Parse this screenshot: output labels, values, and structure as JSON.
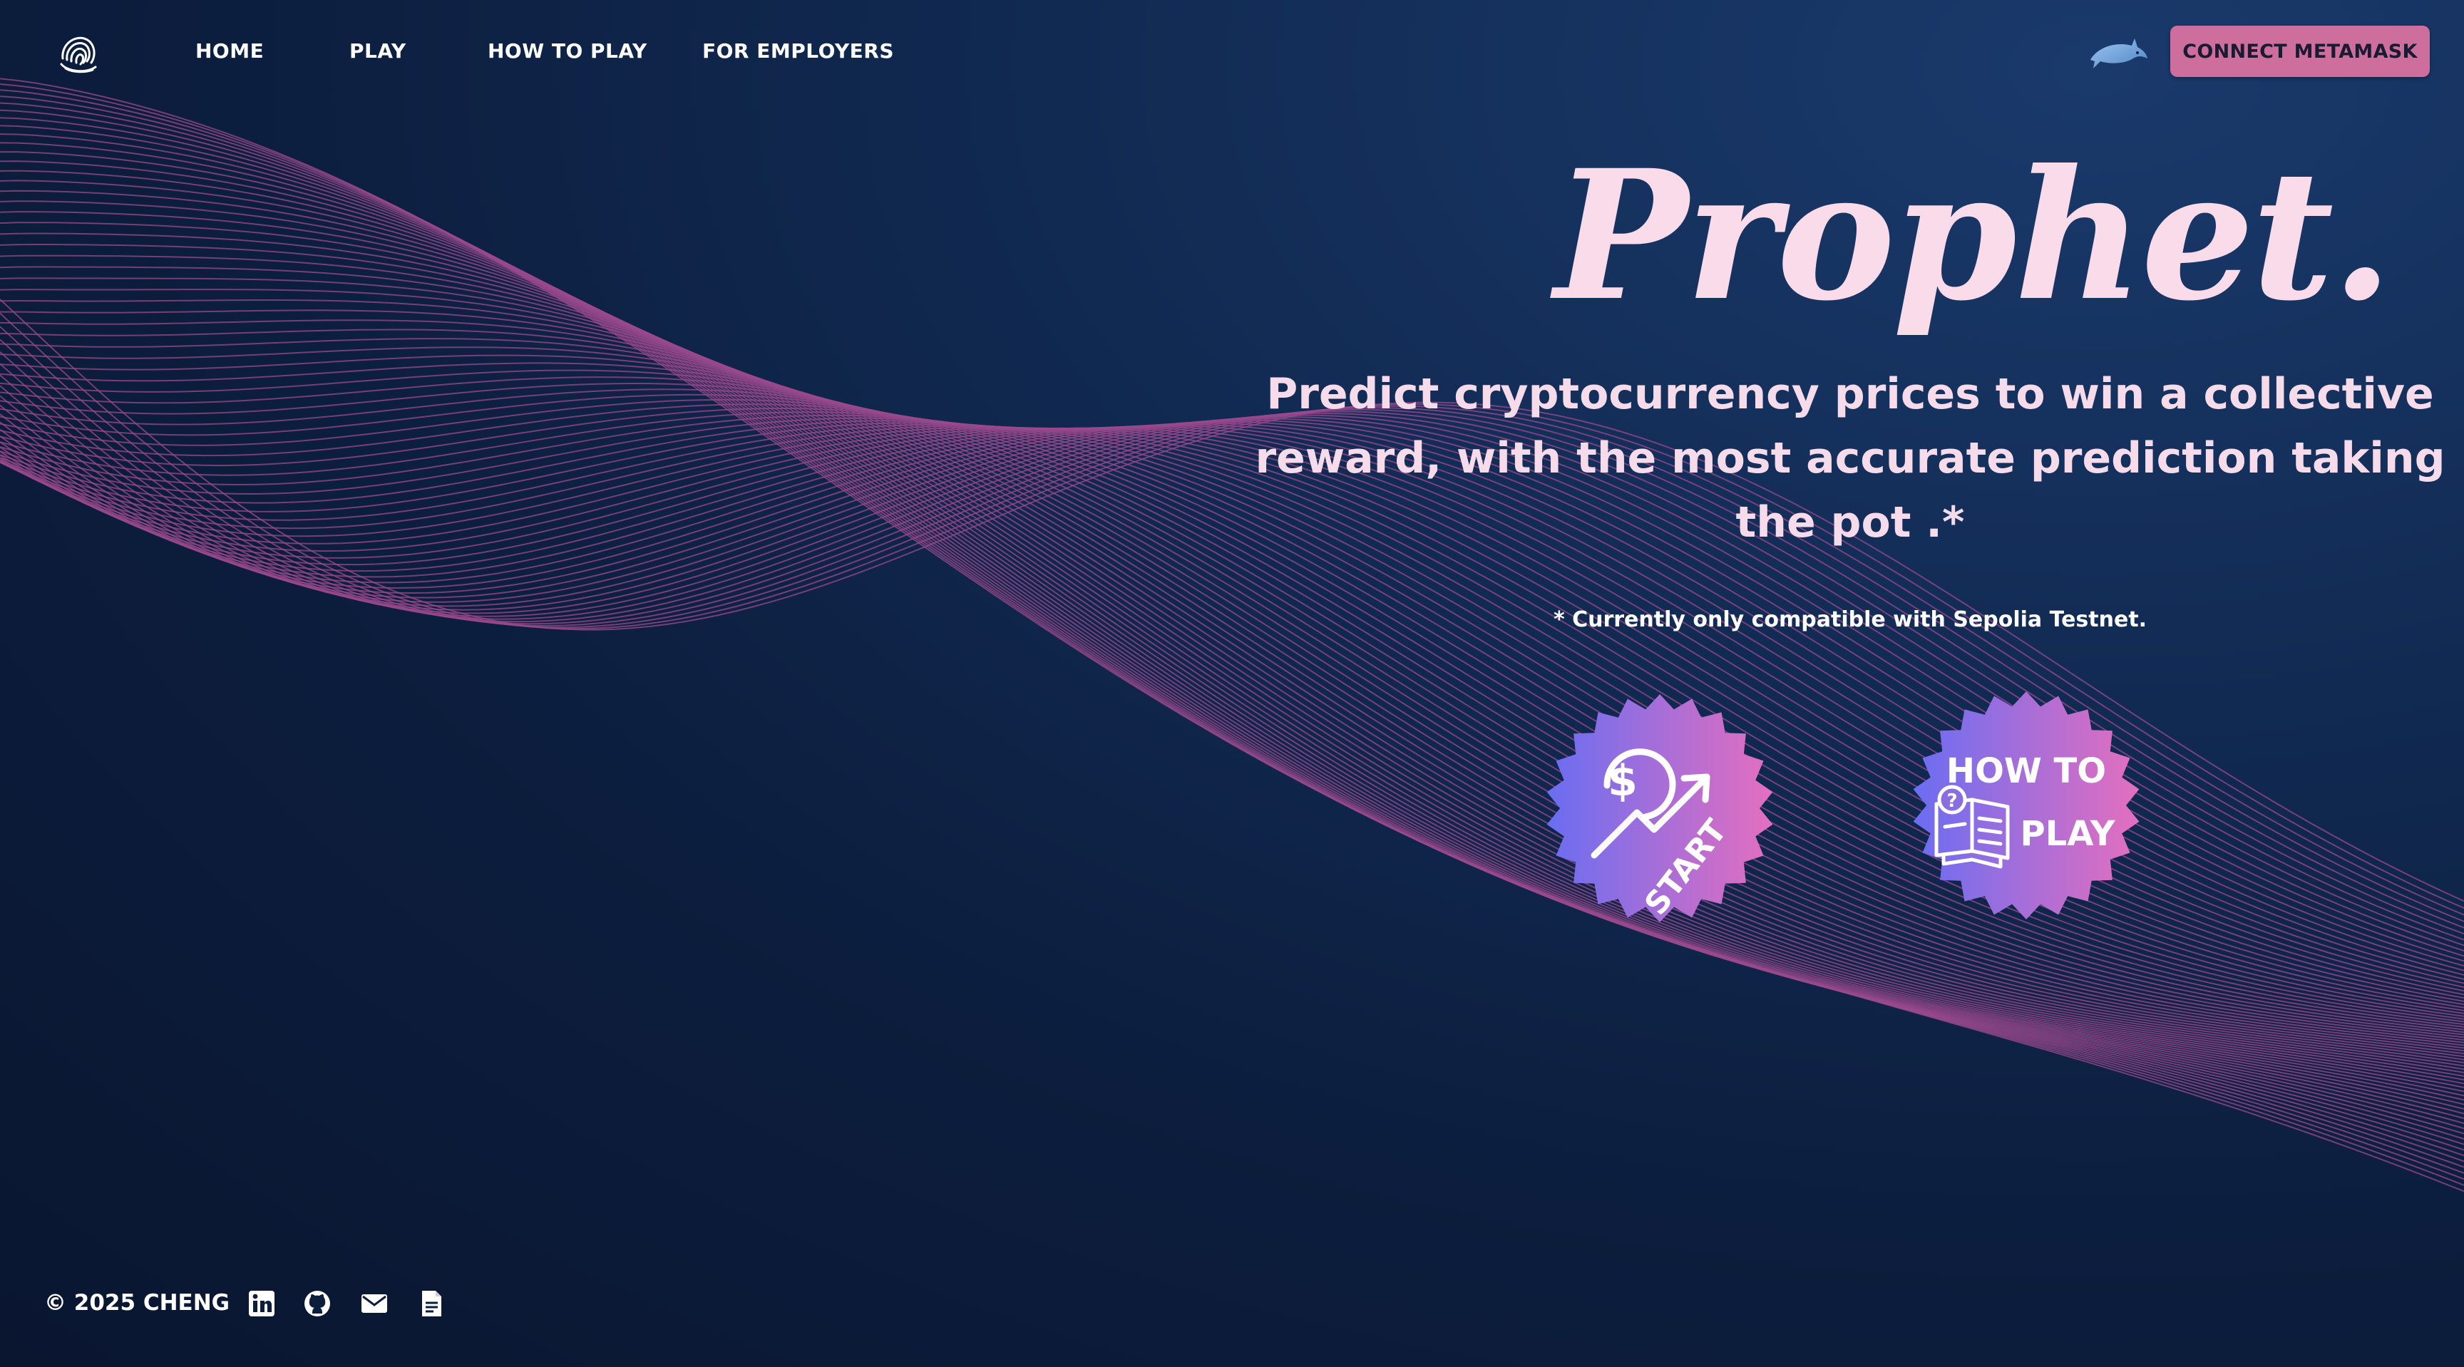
{
  "nav": {
    "links": [
      {
        "label": "HOME"
      },
      {
        "label": "PLAY"
      },
      {
        "label": "HOW TO PLAY"
      },
      {
        "label": "FOR EMPLOYERS"
      }
    ],
    "connect_label": "CONNECT METAMASK",
    "logo_icon": "fingerprint-swirl-icon",
    "wallet_icon": "dolphin-icon"
  },
  "hero": {
    "title": "Prophet.",
    "tagline": "Predict cryptocurrency prices to win a collective reward, with the most accurate prediction taking the pot .*",
    "note": "* Currently only compatible with Sepolia Testnet.",
    "start_badge": {
      "label": "START",
      "icon": "dollar-growth-icon"
    },
    "howto_badge": {
      "line1": "HOW TO",
      "line2": "PLAY",
      "icon": "question-book-icon"
    }
  },
  "footer": {
    "copyright": "© 2025 CHENG",
    "icons": [
      "linkedin-icon",
      "github-icon",
      "email-icon",
      "document-icon"
    ]
  },
  "colors": {
    "accent_pink": "#cd6e9c",
    "title_pink": "#f9dbe9",
    "wave_line": "#9a4a8e",
    "badge_gradient_start": "#6a6df2",
    "badge_gradient_end": "#e46fbe",
    "background": "#0c1d3d"
  }
}
